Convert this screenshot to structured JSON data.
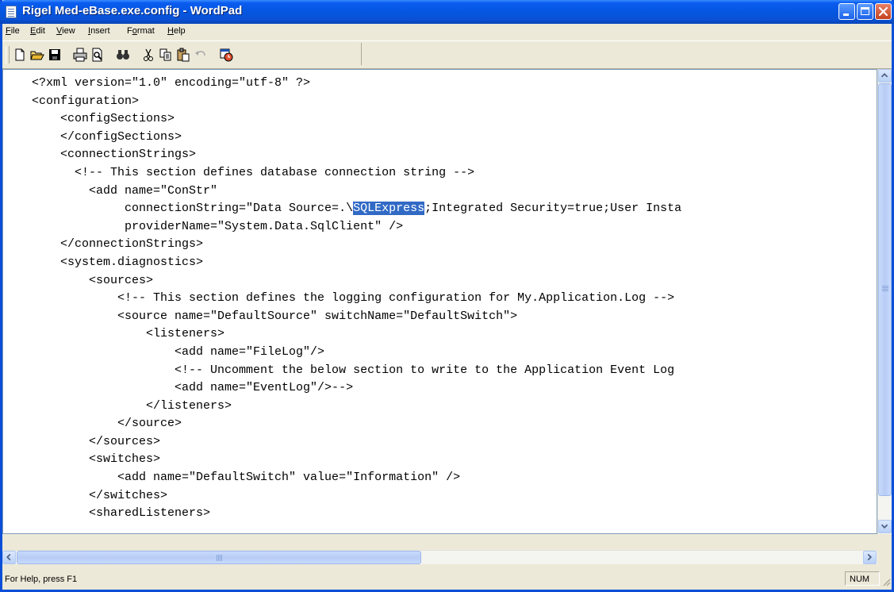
{
  "window": {
    "title": "Rigel Med-eBase.exe.config - WordPad"
  },
  "menu": [
    {
      "pre": "",
      "acc": "F",
      "post": "ile"
    },
    {
      "pre": "",
      "acc": "E",
      "post": "dit"
    },
    {
      "pre": "",
      "acc": "V",
      "post": "iew"
    },
    {
      "pre": "",
      "acc": "I",
      "post": "nsert"
    },
    {
      "pre": "F",
      "acc": "o",
      "post": "rmat"
    },
    {
      "pre": "",
      "acc": "H",
      "post": "elp"
    }
  ],
  "toolbar": {
    "buttons": [
      "new-document-icon",
      "open-folder-icon",
      "save-disk-icon",
      "print-icon",
      "print-preview-icon",
      "find-binoculars-icon",
      "cut-scissors-icon",
      "copy-icon",
      "paste-icon",
      "undo-icon",
      "date-time-icon"
    ]
  },
  "document": {
    "lines": [
      "<?xml version=\"1.0\" encoding=\"utf-8\" ?>",
      "<configuration>",
      "    <configSections>",
      "    </configSections>",
      "    <connectionStrings>",
      "      <!-- This section defines database connection string -->",
      "        <add name=\"ConStr\"",
      "             connectionString=\"Data Source=.\\SQLExpress;Integrated Security=true;User Insta",
      "             providerName=\"System.Data.SqlClient\" />",
      "    </connectionStrings>",
      "    <system.diagnostics>",
      "        <sources>",
      "            <!-- This section defines the logging configuration for My.Application.Log -->",
      "            <source name=\"DefaultSource\" switchName=\"DefaultSwitch\">",
      "                <listeners>",
      "                    <add name=\"FileLog\"/>",
      "                    <!-- Uncomment the below section to write to the Application Event Log",
      "                    <add name=\"EventLog\"/>-->",
      "                </listeners>",
      "            </source>",
      "        </sources>",
      "        <switches>",
      "            <add name=\"DefaultSwitch\" value=\"Information\" />",
      "        </switches>",
      "        <sharedListeners>"
    ],
    "selection": {
      "line": 7,
      "before": "             connectionString=\"Data Source=.\\",
      "selected": "SQLExpress",
      "after": ";Integrated Security=true;User Insta"
    }
  },
  "statusbar": {
    "help_text": "For Help, press F1",
    "num_indicator": "NUM"
  },
  "colors": {
    "titlebar": "#0556e0",
    "selection": "#316ac5",
    "chrome": "#ece9d8"
  }
}
